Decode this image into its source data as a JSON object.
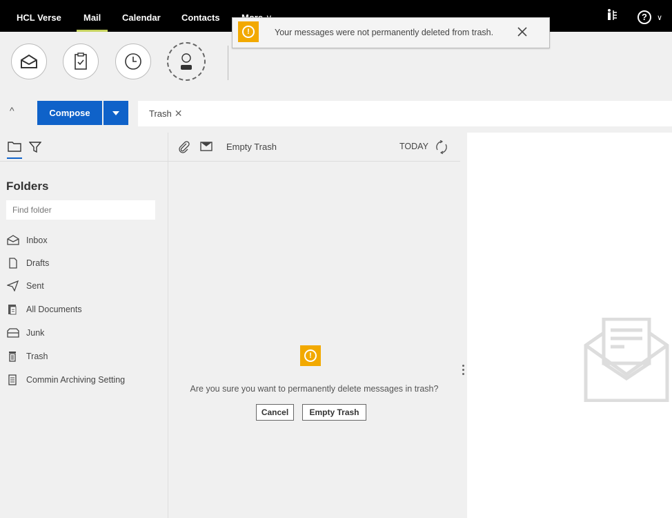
{
  "nav": {
    "brand": "HCL Verse",
    "items": [
      "Mail",
      "Calendar",
      "Contacts",
      "More"
    ],
    "more_caret": "∨",
    "help_glyph": "?",
    "help_caret": "∨",
    "people_icon": "people-directory-icon"
  },
  "toolbar": {
    "buttons": [
      "mail-open-icon",
      "clipboard-check-icon",
      "clock-icon",
      "person-icon"
    ]
  },
  "compose": {
    "collapse_glyph": "^",
    "compose_label": "Compose",
    "filter_chip": "Trash",
    "filter_chip_close": "✕"
  },
  "folders": {
    "title": "Folders",
    "find_placeholder": "Find folder",
    "items": [
      {
        "label": "Inbox",
        "icon": "inbox-icon"
      },
      {
        "label": "Drafts",
        "icon": "drafts-icon"
      },
      {
        "label": "Sent",
        "icon": "sent-icon"
      },
      {
        "label": "All Documents",
        "icon": "all-documents-icon"
      },
      {
        "label": "Junk",
        "icon": "junk-icon"
      },
      {
        "label": "Trash",
        "icon": "trash-icon"
      },
      {
        "label": "Commin Archiving Setting",
        "icon": "archive-icon"
      }
    ]
  },
  "list": {
    "empty_trash_link": "Empty Trash",
    "today_label": "TODAY",
    "warn_glyph": "!",
    "confirm_text": "Are you sure you want to permanently delete messages in trash?",
    "cancel_label": "Cancel",
    "confirm_label": "Empty Trash"
  },
  "toast": {
    "warn_glyph": "!",
    "message": "Your messages were not permanently deleted from trash."
  },
  "colors": {
    "accent": "#0f62c9",
    "warning": "#f2a900",
    "nav_active": "#c7d35f"
  }
}
